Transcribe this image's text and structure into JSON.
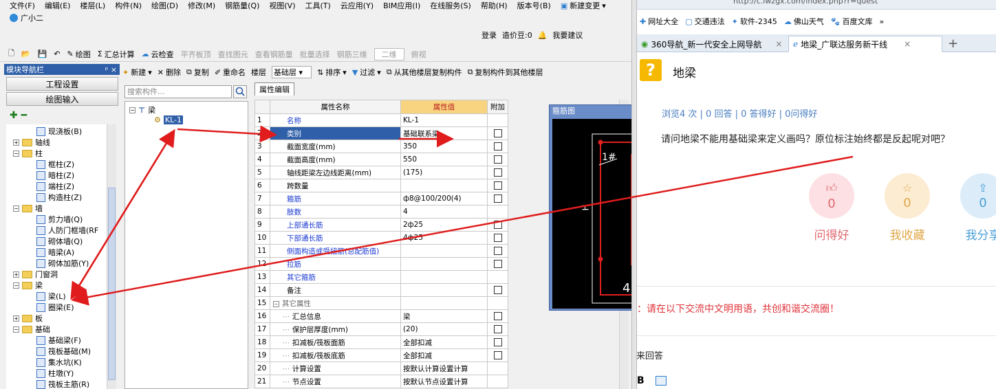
{
  "menu": [
    "文件(F)",
    "编辑(E)",
    "楼层(L)",
    "构件(N)",
    "绘图(D)",
    "修改(M)",
    "钢筋量(Q)",
    "视图(V)",
    "工具(T)",
    "云应用(Y)",
    "BIM应用(I)",
    "在线服务(S)",
    "帮助(H)",
    "版本号(B)"
  ],
  "new_change": "新建变更",
  "assistant": "广小二",
  "login": {
    "login": "登录",
    "price": "造价豆:0",
    "suggest": "我要建议"
  },
  "toolbar1": {
    "draw": "绘图",
    "sum": "汇总计算",
    "cloud": "云检查",
    "level_top": "平齐板顶",
    "find": "查找图元",
    "view_steel": "查看钢筋量",
    "batch": "批量选择",
    "steel3d": "钢筋三维",
    "view2d": "二维",
    "view_top": "俯视"
  },
  "nav": {
    "title": "模块导航栏",
    "pin": "ᵖ ×",
    "project_settings": "工程设置",
    "draw_input": "绘图输入"
  },
  "tree": [
    {
      "label": "现浇板(B)",
      "level": 2
    },
    {
      "label": "轴线",
      "level": 1,
      "exp": "+"
    },
    {
      "label": "柱",
      "level": 1,
      "exp": "-"
    },
    {
      "label": "框柱(Z)",
      "level": 2
    },
    {
      "label": "暗柱(Z)",
      "level": 2
    },
    {
      "label": "端柱(Z)",
      "level": 2
    },
    {
      "label": "构造柱(Z)",
      "level": 2
    },
    {
      "label": "墙",
      "level": 1,
      "exp": "-"
    },
    {
      "label": "剪力墙(Q)",
      "level": 2
    },
    {
      "label": "人防门框墙(RF",
      "level": 2
    },
    {
      "label": "砌体墙(Q)",
      "level": 2
    },
    {
      "label": "暗梁(A)",
      "level": 2
    },
    {
      "label": "砌体加筋(Y)",
      "level": 2
    },
    {
      "label": "门窗洞",
      "level": 1,
      "exp": "+"
    },
    {
      "label": "梁",
      "level": 1,
      "exp": "-"
    },
    {
      "label": "梁(L)",
      "level": 2
    },
    {
      "label": "圈梁(E)",
      "level": 2
    },
    {
      "label": "板",
      "level": 1,
      "exp": "+"
    },
    {
      "label": "基础",
      "level": 1,
      "exp": "-"
    },
    {
      "label": "基础梁(F)",
      "level": 2
    },
    {
      "label": "筏板基础(M)",
      "level": 2
    },
    {
      "label": "集水坑(K)",
      "level": 2
    },
    {
      "label": "柱墩(Y)",
      "level": 2
    },
    {
      "label": "筏板主筋(R)",
      "level": 2
    }
  ],
  "toolbar2": {
    "new": "新建",
    "delete": "删除",
    "copy": "复制",
    "rename": "重命名",
    "floor_label": "楼层",
    "floor_value": "基础层",
    "sort": "排序",
    "filter": "过滤",
    "copy_from": "从其他楼层复制构件",
    "copy_to": "复制构件到其他楼层"
  },
  "search_placeholder": "搜索构件...",
  "comp_tree": {
    "root": "梁",
    "item": "KL-1"
  },
  "prop_tab": "属性编辑",
  "prop_headers": {
    "name": "属性名称",
    "value": "属性值",
    "add": "附加"
  },
  "props": [
    {
      "n": "1",
      "name": "名称",
      "value": "KL-1",
      "blue": true,
      "chk": false
    },
    {
      "n": "2",
      "name": "类别",
      "value": "基础联系梁",
      "blue": false,
      "chk": true,
      "sel": true
    },
    {
      "n": "3",
      "name": "截面宽度(mm)",
      "value": "350",
      "blue": false,
      "chk": true
    },
    {
      "n": "4",
      "name": "截面高度(mm)",
      "value": "550",
      "blue": false,
      "chk": true
    },
    {
      "n": "5",
      "name": "轴线距梁左边线距离(mm)",
      "value": "(175)",
      "blue": false,
      "chk": true
    },
    {
      "n": "6",
      "name": "跨数量",
      "value": "",
      "blue": false,
      "chk": true
    },
    {
      "n": "7",
      "name": "箍筋",
      "value": "ф8@100/200(4)",
      "blue": true,
      "chk": true
    },
    {
      "n": "8",
      "name": "肢数",
      "value": "4",
      "blue": true,
      "chk": false
    },
    {
      "n": "9",
      "name": "上部通长筋",
      "value": "2ф25",
      "blue": true,
      "chk": true
    },
    {
      "n": "10",
      "name": "下部通长筋",
      "value": "4ф25",
      "blue": true,
      "chk": true
    },
    {
      "n": "11",
      "name": "侧面构造或受扭筋(总配筋值)",
      "value": "",
      "blue": true,
      "chk": true
    },
    {
      "n": "12",
      "name": "拉筋",
      "value": "",
      "blue": true,
      "chk": true
    },
    {
      "n": "13",
      "name": "其它箍筋",
      "value": "",
      "blue": true,
      "chk": false
    },
    {
      "n": "14",
      "name": "备注",
      "value": "",
      "blue": false,
      "chk": true
    },
    {
      "n": "15",
      "name": "其它属性",
      "value": "",
      "blue": false,
      "chk": false,
      "group": true
    },
    {
      "n": "16",
      "name": "汇总信息",
      "value": "梁",
      "blue": false,
      "chk": true,
      "sub": true
    },
    {
      "n": "17",
      "name": "保护层厚度(mm)",
      "value": "(20)",
      "blue": false,
      "chk": true,
      "sub": true
    },
    {
      "n": "18",
      "name": "扣减板/筏板面筋",
      "value": "全部扣减",
      "blue": false,
      "chk": true,
      "sub": true
    },
    {
      "n": "19",
      "name": "扣减板/筏板底筋",
      "value": "全部扣减",
      "blue": false,
      "chk": true,
      "sub": true
    },
    {
      "n": "20",
      "name": "计算设置",
      "value": "按默认计算设置计算",
      "blue": false,
      "chk": false,
      "sub": true
    },
    {
      "n": "21",
      "name": "节点设置",
      "value": "按默认节点设置计算",
      "blue": false,
      "chk": false,
      "sub": true
    }
  ],
  "gjt": {
    "title": "箍筋图",
    "label1": "1#",
    "h": "H",
    "four": "4"
  },
  "browser": {
    "url": "http://c.lwzgx.com/index.php?r=quest",
    "favs": [
      "网址大全",
      "交通违法",
      "软件-2345",
      "佛山天气",
      "百度文库"
    ],
    "tabs": [
      "360导航_新一代安全上网导航",
      "地梁_广联达服务新干线"
    ],
    "q_icon": "?",
    "q_title": "地梁",
    "stats": "浏览4 次 | 0 回答 | 0 答得好 | 0问得好",
    "question": "请问地梁不能用基础梁来定义画吗？原位标注始终都是反起呢对吧？",
    "actions": [
      {
        "count": "0",
        "label": "问得好"
      },
      {
        "count": "0",
        "label": "我收藏"
      },
      {
        "count": "0",
        "label": "我分享"
      }
    ],
    "notice": "注：请在以下交流中文明用语，共创和谐交流圈！",
    "answer": "我来回答",
    "editor_b": "B"
  },
  "colors": {
    "nav": "#2f5fa8",
    "arrow": "#e01c1c",
    "good": "#e06a72",
    "fav": "#e0a84a",
    "share": "#4a9fd8"
  }
}
